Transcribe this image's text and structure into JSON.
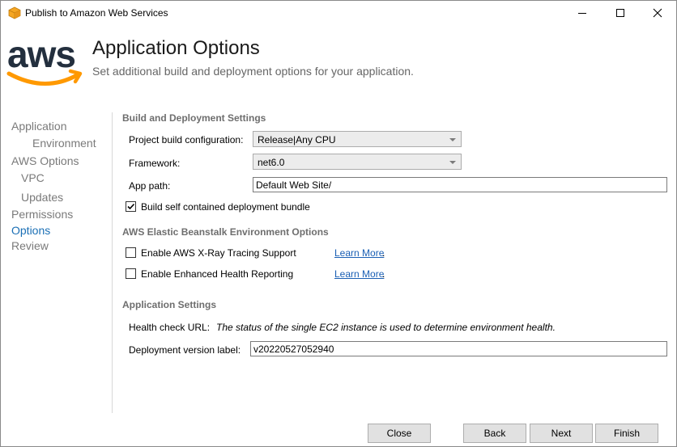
{
  "window": {
    "title": "Publish to Amazon Web Services"
  },
  "header": {
    "title": "Application Options",
    "subtitle": "Set additional build and deployment options for your application.",
    "logo_text": "aws"
  },
  "nav": {
    "items": [
      {
        "label": "Application",
        "active": false
      },
      {
        "label": "Environment",
        "active": false
      },
      {
        "label": "AWS Options",
        "active": false
      },
      {
        "label": "VPC",
        "active": false
      },
      {
        "label": "Updates",
        "active": false
      },
      {
        "label": "Permissions",
        "active": false
      },
      {
        "label": "Options",
        "active": true
      },
      {
        "label": "Review",
        "active": false
      }
    ]
  },
  "build": {
    "section_title": "Build and Deployment Settings",
    "config_label": "Project build configuration:",
    "config_value": "Release|Any CPU",
    "framework_label": "Framework:",
    "framework_value": "net6.0",
    "app_path_label": "App path:",
    "app_path_value": "Default Web Site/",
    "self_contained_label": "Build self contained deployment bundle",
    "self_contained_checked": true
  },
  "beanstalk": {
    "section_title": "AWS Elastic Beanstalk Environment Options",
    "xray_label": "Enable AWS X-Ray Tracing Support",
    "xray_checked": false,
    "xray_link": "Learn More",
    "health_label": "Enable Enhanced Health Reporting",
    "health_checked": false,
    "health_link": "Learn More"
  },
  "app_settings": {
    "section_title": "Application Settings",
    "health_url_label": "Health check URL:",
    "health_url_note": "The status of the single EC2 instance is used to determine environment health.",
    "version_label": "Deployment version label:",
    "version_value": "v20220527052940"
  },
  "buttons": {
    "close": "Close",
    "back": "Back",
    "next": "Next",
    "finish": "Finish"
  },
  "colors": {
    "aws_dark": "#232f3e",
    "aws_orange": "#ff9900",
    "nav_active": "#1a6fb5",
    "link": "#1a5fb4"
  }
}
